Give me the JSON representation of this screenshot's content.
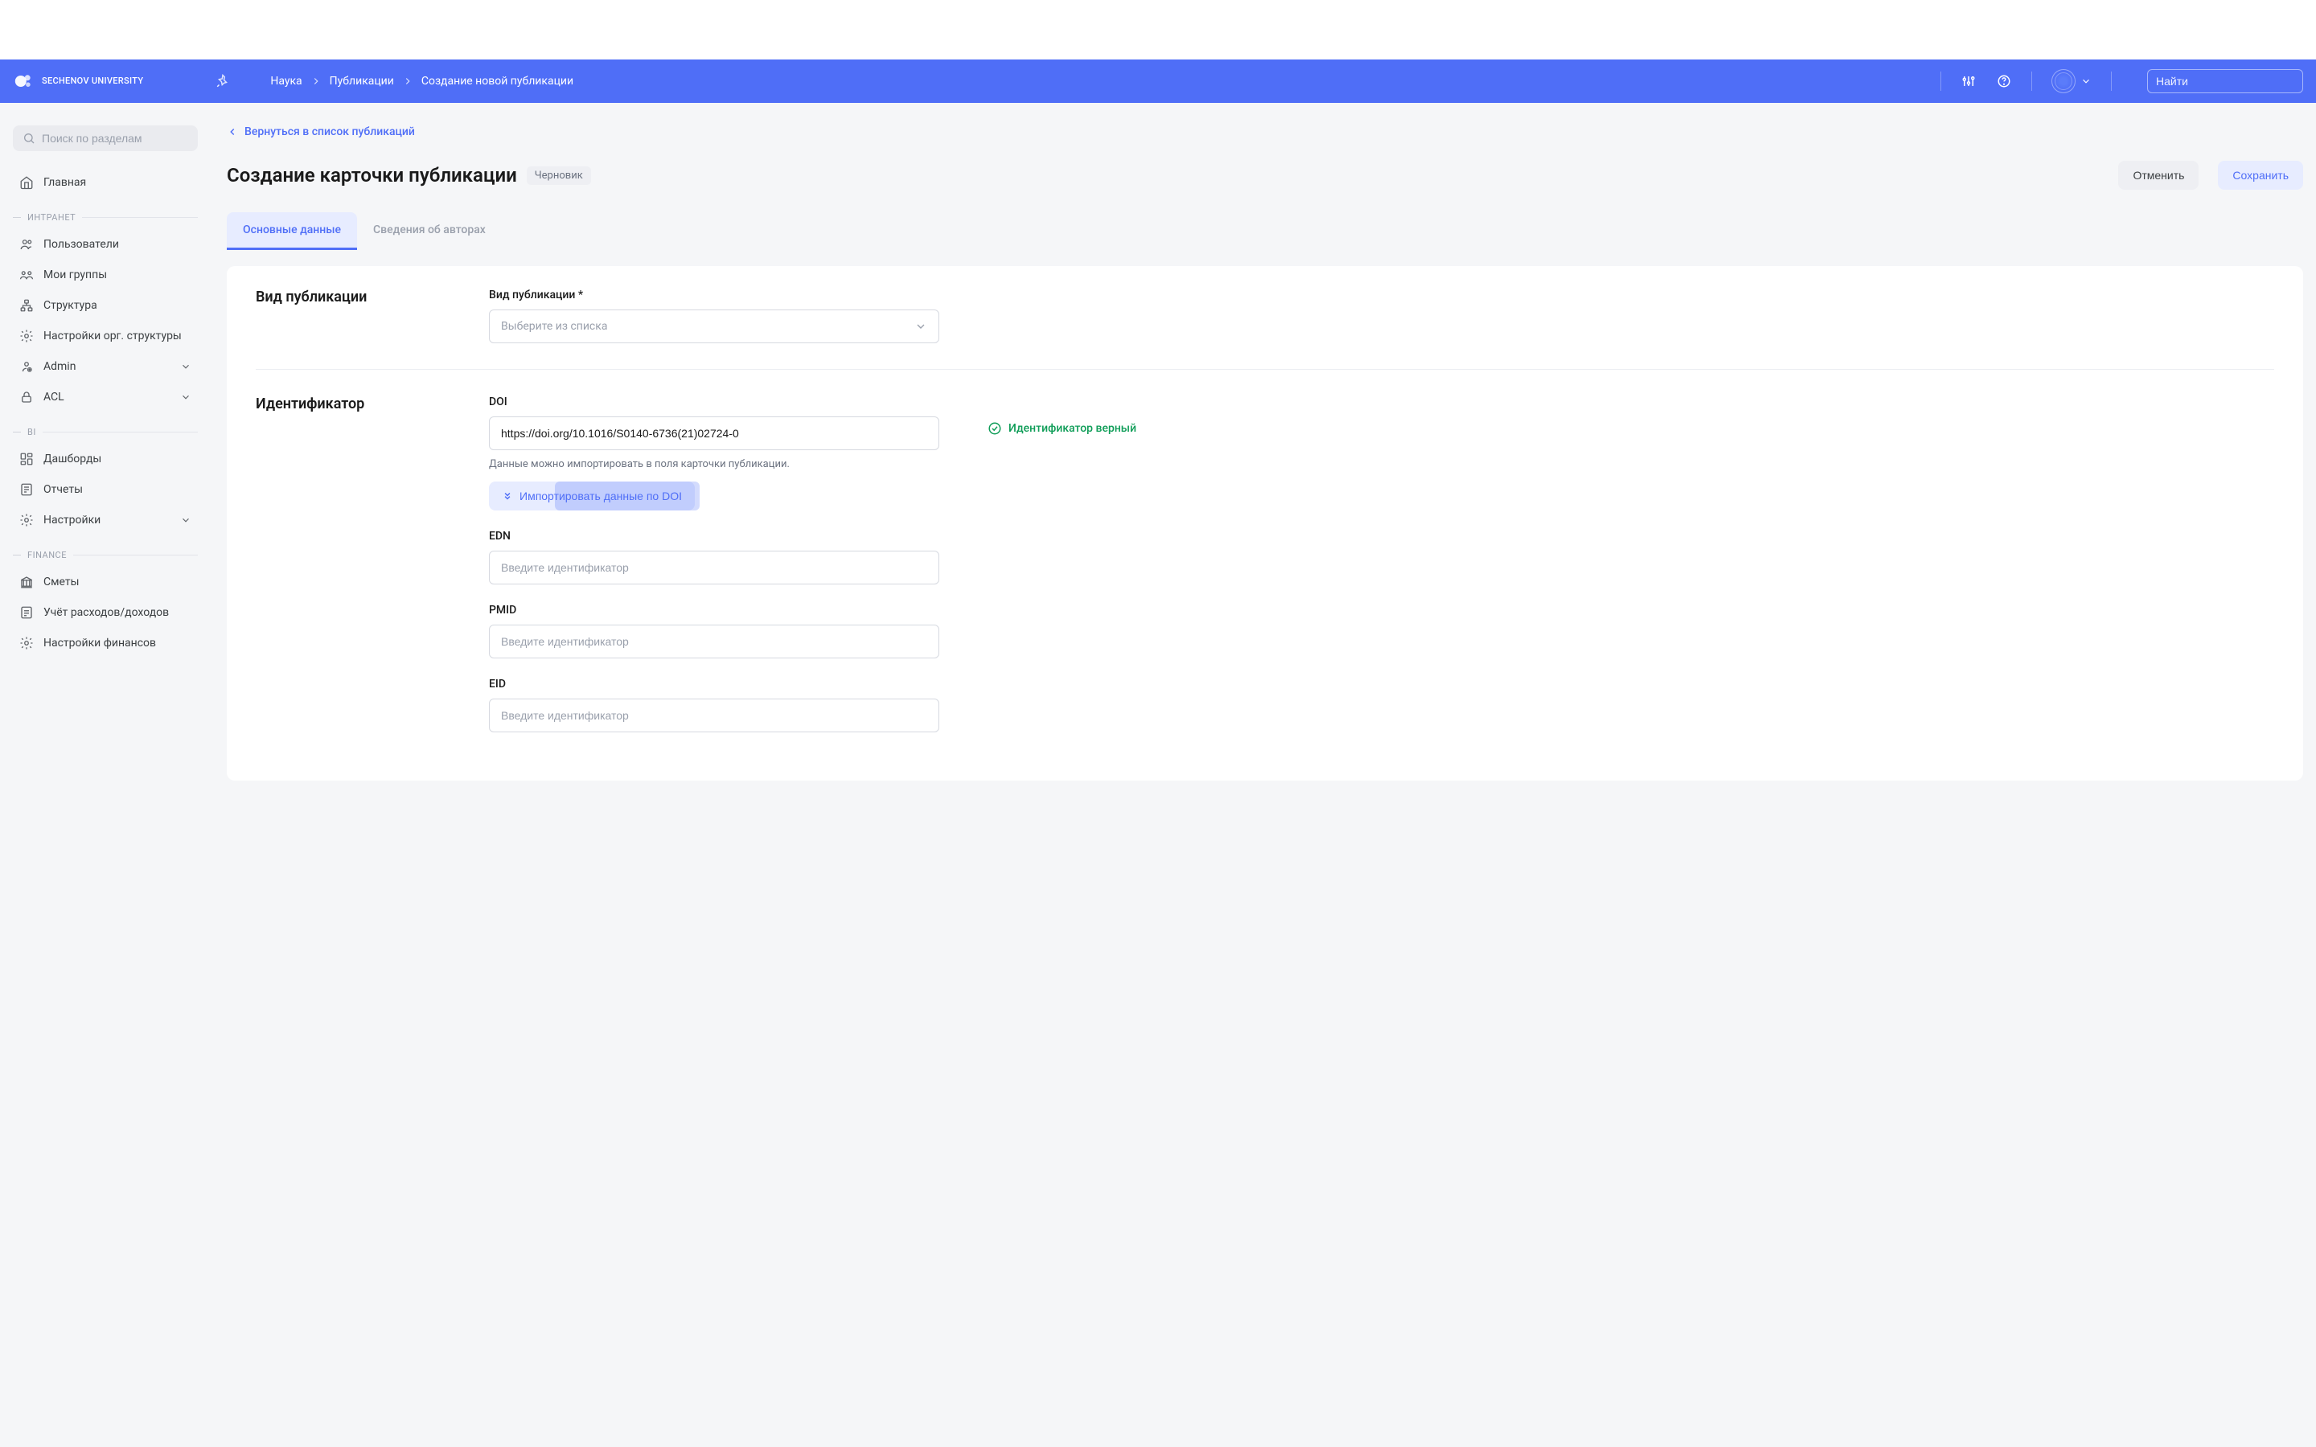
{
  "header": {
    "logo_text": "Sechenov University",
    "breadcrumb": [
      "Наука",
      "Публикации",
      "Создание новой публикации"
    ],
    "search_placeholder": "Найти"
  },
  "sidebar": {
    "search_placeholder": "Поиск по разделам",
    "home": "Главная",
    "sections": {
      "intranet": {
        "label": "ИНТРАНЕТ",
        "items": [
          "Пользователи",
          "Мои группы",
          "Структура",
          "Настройки орг. структуры",
          "Admin",
          "ACL"
        ]
      },
      "bi": {
        "label": "BI",
        "items": [
          "Дашборды",
          "Отчеты",
          "Настройки"
        ]
      },
      "finance": {
        "label": "FINANCE",
        "items": [
          "Сметы",
          "Учёт расходов/доходов",
          "Настройки финансов"
        ]
      }
    }
  },
  "main": {
    "back": "Вернуться в список публикаций",
    "title": "Создание карточки публикации",
    "badge": "Черновик",
    "cancel": "Отменить",
    "save": "Сохранить",
    "tabs": {
      "main": "Основные данные",
      "authors": "Сведения об авторах"
    },
    "section_kind": {
      "title": "Вид публикации",
      "label": "Вид публикации",
      "placeholder": "Выберите из списка"
    },
    "section_id": {
      "title": "Идентификатор",
      "doi_label": "DOI",
      "doi_value": "https://doi.org/10.1016/S0140-6736(21)02724-0",
      "doi_hint": "Данные можно импортировать в поля карточки публикации.",
      "import_btn": "Импортировать данные по DOI",
      "valid_text": "Идентификатор верный",
      "edn_label": "EDN",
      "edn_placeholder": "Введите идентификатор",
      "pmid_label": "PMID",
      "pmid_placeholder": "Введите идентификатор",
      "eid_label": "EID",
      "eid_placeholder": "Введите идентификатор"
    }
  }
}
